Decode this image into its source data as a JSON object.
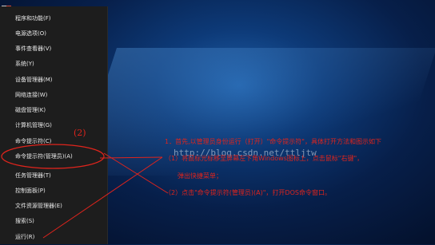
{
  "menu": {
    "items": [
      {
        "label": "程序和功能(F)"
      },
      {
        "label": "电源选项(O)"
      },
      {
        "label": "事件查看器(V)"
      },
      {
        "label": "系统(Y)"
      },
      {
        "label": "设备管理器(M)"
      },
      {
        "label": "网络连接(W)"
      },
      {
        "label": "磁盘管理(K)"
      },
      {
        "label": "计算机管理(G)"
      },
      {
        "label": "命令提示符(C)"
      },
      {
        "label": "命令提示符(管理员)(A)"
      },
      {
        "label": "任务管理器(T)"
      },
      {
        "label": "控制面板(P)"
      },
      {
        "label": "文件资源管理器(E)"
      },
      {
        "label": "搜索(S)"
      },
      {
        "label": "运行(R)"
      }
    ]
  },
  "annotation": {
    "step_number": "(2)",
    "line1": "1．首先,以管理员身份运行（打开）\"命令提示符\"，具体打开方法和图示如下",
    "line2": "（1）将鼠标光标移至屏幕左下角Windows图标上，点击鼠标\"右键\"，",
    "line3": "弹出快捷菜单；",
    "line4": "（2）点击\"命令提示符(管理员)(A)\"，打开DOS命令窗口。",
    "color": "#e0241c"
  },
  "watermark": "http://blog.csdn.net/ttljtw"
}
